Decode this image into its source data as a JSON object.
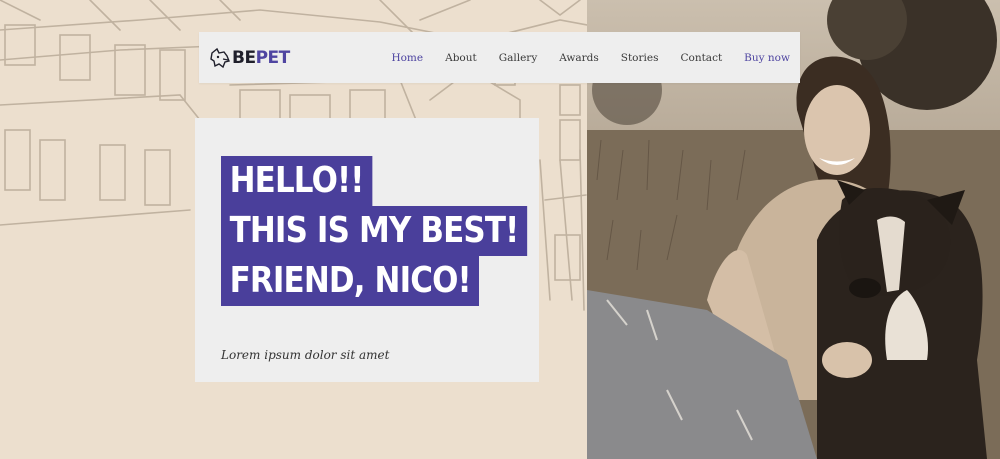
{
  "header": {
    "logo": {
      "part1": "BE",
      "part2": "PET"
    },
    "nav": [
      {
        "label": "Home"
      },
      {
        "label": "About"
      },
      {
        "label": "Gallery"
      },
      {
        "label": "Awards"
      },
      {
        "label": "Stories"
      },
      {
        "label": "Contact"
      },
      {
        "label": "Buy now"
      }
    ]
  },
  "hero": {
    "lines": [
      "HELLO!!",
      "THIS IS MY BEST!",
      "FRIEND, NICO!"
    ],
    "subtitle": "Lorem ipsum dolor sit amet"
  },
  "colors": {
    "accent": "#4a3f9b",
    "background": "#ecdfce",
    "card": "#eeeeee"
  },
  "icons": {
    "logo": "dog-head-icon"
  }
}
